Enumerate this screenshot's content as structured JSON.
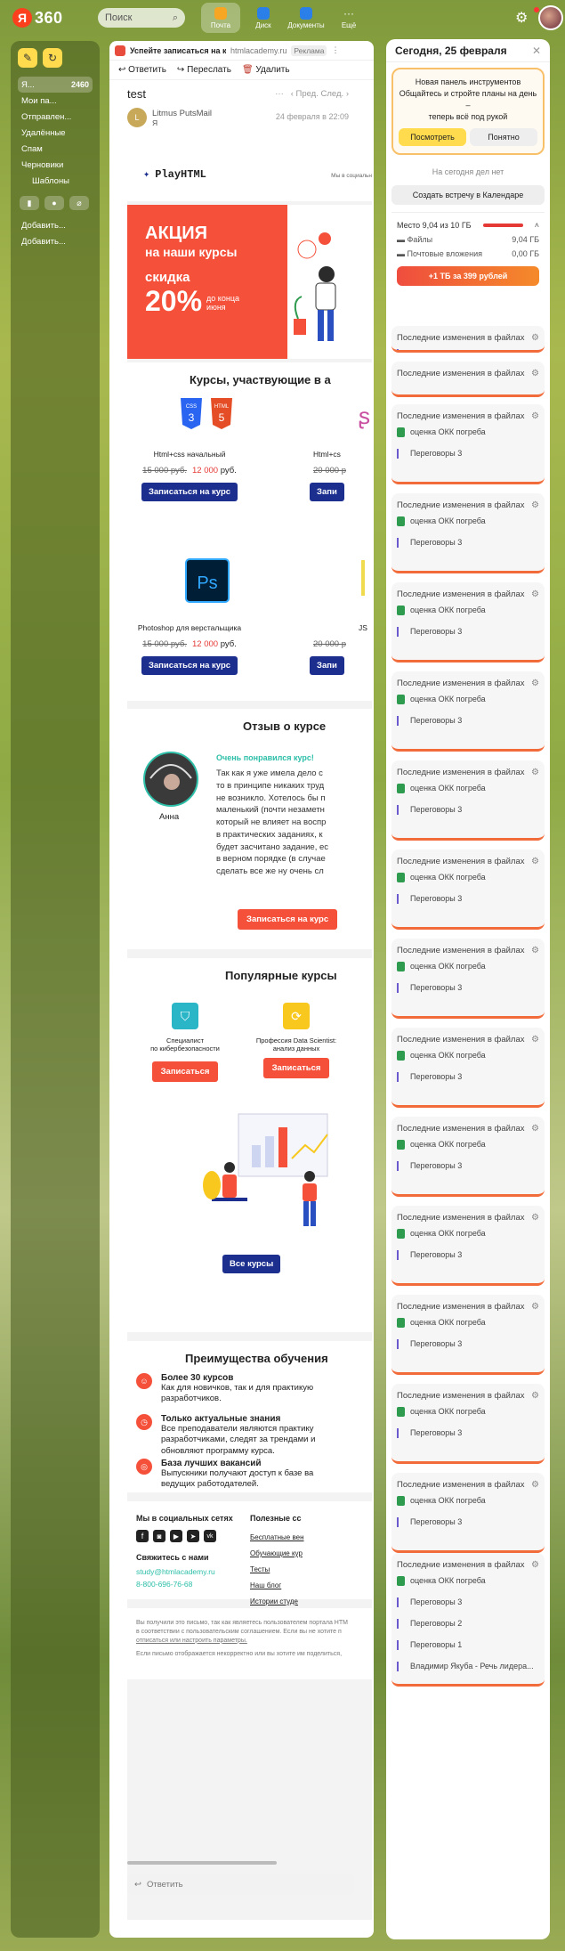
{
  "header": {
    "logo_letter": "Я",
    "logo_text": "360",
    "search_placeholder": "Поиск",
    "apps": [
      {
        "label": "Почта",
        "color": "#f6a623"
      },
      {
        "label": "Диск",
        "color": "#2a7fe8"
      },
      {
        "label": "Документы",
        "color": "#2a7fe8"
      },
      {
        "label": "Ещё",
        "color": "#ffffff"
      }
    ]
  },
  "sidebar": {
    "items": [
      {
        "label": "Я...",
        "count": "2460",
        "selected": true
      },
      {
        "label": "Мои па...",
        "count": ""
      },
      {
        "label": "Отправлен...",
        "count": ""
      },
      {
        "label": "Удалённые",
        "count": ""
      },
      {
        "label": "Спам",
        "count": ""
      },
      {
        "label": "Черновики",
        "count": ""
      },
      {
        "label": "Шаблоны",
        "count": ""
      }
    ],
    "add1": "Добавить...",
    "add2": "Добавить..."
  },
  "mail": {
    "ad_title": "Успейте записаться на кур...",
    "ad_domain": "htmlacademy.ru",
    "ad_badge": "Реклама",
    "toolbar": {
      "reply": "Ответить",
      "forward": "Переслать",
      "delete": "Удалить"
    },
    "subject": "test",
    "nav_prev": "Пред.",
    "nav_next": "След.",
    "sender_initial": "L",
    "sender_name": "Litmus PutsMail",
    "sender_to": "Я",
    "date": "24 февраля в 22:09",
    "reply_placeholder": "Ответить"
  },
  "email": {
    "brand": "PlayHTML",
    "brand_note": "Мы в социальн",
    "promo": {
      "line1": "АКЦИЯ",
      "line2": "на наши курсы",
      "line3": "скидка",
      "percent": "20%",
      "until1": "до конца",
      "until2": "июня"
    },
    "courses_title": "Курсы, участвующие в а",
    "courses": [
      {
        "name": "Html+css начальный",
        "old": "15 000 руб.",
        "new": "12 000",
        "cur": "руб.",
        "btn": "Записаться на курс"
      },
      {
        "name": "Html+cs",
        "old": "20 000 р",
        "new": "",
        "cur": "",
        "btn": "Запи"
      },
      {
        "name": "Photoshop для верстальщика",
        "old": "15 000 руб.",
        "new": "12 000",
        "cur": "руб.",
        "btn": "Записаться на курс"
      },
      {
        "name": "JS",
        "old": "20 000 р",
        "new": "",
        "cur": "",
        "btn": "Запи"
      }
    ],
    "css_label": "CSS",
    "html_label": "HTML",
    "ps_label": "Ps",
    "review_title": "Отзыв о курсе",
    "review_person": "Анна",
    "review_tag": "Очень понравился курс!",
    "review_lines": [
      "Так как я уже имела дело с",
      "то в принципе никаких труд",
      "не возникло. Хотелось бы п",
      "маленький (почти незаметн",
      "который не влияет на воспр",
      "в практических заданиях, к",
      "будет засчитано задание, ес",
      "в верном порядке (в случае",
      "сделать все же ну очень сл"
    ],
    "review_btn": "Записаться на курс",
    "popular_title": "Популярные курсы",
    "popular": [
      {
        "l1": "Специалист",
        "l2": "по кибербезопасности",
        "btn": "Записаться"
      },
      {
        "l1": "Профессия Data Scientist:",
        "l2": "анализ данных",
        "btn": "Записаться"
      }
    ],
    "all_courses": "Все курсы",
    "adv_title": "Преимущества обучения",
    "adv": [
      {
        "t": "Более 30 курсов",
        "d1": "Как для новичков, так и для практикую",
        "d2": "разработчиков."
      },
      {
        "t": "Только актуальные знания",
        "d1": "Все преподаватели являются практику",
        "d2": "разработчиками, следят за трендами и",
        "d3": "обновляют программу курса."
      },
      {
        "t": "База лучших вакансий",
        "d1": "Выпускники получают доступ к базе ва",
        "d2": "ведущих работодателей."
      }
    ],
    "social_title": "Мы в социальных сетях",
    "useful_title": "Полезные сс",
    "useful_links": [
      "Бесплатные вен",
      "Обучающие кур",
      "Тесты",
      "Наш блог",
      "Истории студе"
    ],
    "contact_title": "Свяжитесь с нами",
    "contact_email": "study@htmlacademy.ru",
    "contact_phone": "8-800-696-76-68",
    "footer1": "Вы получили это письмо, так как являетесь пользователем портала HTM",
    "footer2": "в соответствии с пользовательским соглашением. Если вы не хотите п",
    "footer3": "отписаться или настроить параметры.",
    "footer4": "Если письмо отображается некорректно или вы хотите им поделиться,"
  },
  "panel": {
    "title": "Сегодня, 25 февраля",
    "new_title": "Новая панель инструментов",
    "new_text1": "Общайтесь и стройте планы на день –",
    "new_text2": "теперь всё под рукой",
    "btn_view": "Посмотреть",
    "btn_ok": "Понятно",
    "no_deals": "На сегодня дел нет",
    "create_meeting": "Создать встречу в Календаре",
    "space": "Место  9,04 из 10 ГБ",
    "files": "Файлы",
    "files_size": "9,04 ГБ",
    "attachments": "Почтовые вложения",
    "attachments_size": "0,00 ГБ",
    "promo_btn": "+1 ТБ за 399 рублей",
    "card_title": "Последние изменения в файлах",
    "card_file1": "оценка ОКК погреба",
    "card_file2": "Переговоры 3",
    "last_files": [
      "оценка ОКК погреба",
      "Переговоры 3",
      "Переговоры 2",
      "Переговоры 1",
      "Владимир Якуба - Речь лидера..."
    ]
  }
}
